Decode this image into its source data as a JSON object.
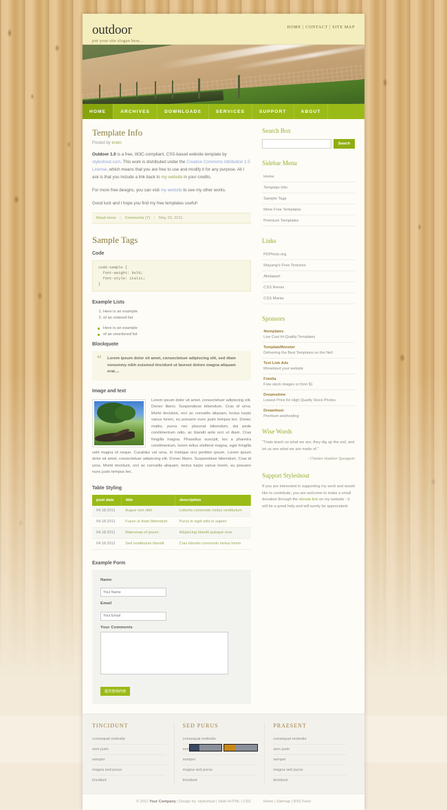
{
  "site": {
    "logo": "outdoor",
    "slogan": "put your site slogan here...",
    "toplinks": [
      "HOME",
      "CONTACT",
      "SITE MAP"
    ],
    "nav": [
      "HOME",
      "ARCHIVES",
      "DOWNLOADS",
      "SERVICES",
      "SUPPORT",
      "ABOUT"
    ],
    "nav_active": "HOME",
    "banner_image": "coastal-beach-fence-photo"
  },
  "post": {
    "title": "Template Info",
    "meta_prefix": "Posted by",
    "meta_author": "erwin",
    "p1_lead": "Outdoor 1.0",
    "p1_a": " is a free, W3C-compliant, CSS-based website template by ",
    "p1_link1": "styleshout.com",
    "p1_b": ". This work is distributed under the ",
    "p1_link2": "Creative Commons Attribution 2.5 License",
    "p1_c": ", which means that you are free to use and modify it for any purpose. All I ask is that you include a link back to ",
    "p1_link3": "my website",
    "p1_d": " in your credits.",
    "p2_a": "For more free designs, you can visit ",
    "p2_link": "my website",
    "p2_b": " to see my other works.",
    "p3": "Good luck and I hope you find my free templates useful!",
    "footer_readmore": "Read more",
    "footer_comments": "Comments (7)",
    "footer_date": "May 20, 2011"
  },
  "sample_tags": {
    "title": "Sample Tags",
    "code_heading": "Code",
    "code_text": "code-sample {\n  font-weight: bold;\n  font-style: italic;\n}",
    "lists_heading": "Example Lists",
    "ordered": [
      "Here is an example",
      "of an ordered list"
    ],
    "unordered": [
      "Here is an example",
      "of an unordered list"
    ],
    "blockquote_heading": "Blockquote",
    "blockquote_mark": "“",
    "blockquote_text": "Lorem ipsum dolor sit amet, consectetuer adipiscing elit, sed diam nonummy nibh euismod tincidunt ut laoreet dolore magna aliquam erat....",
    "imagetext_heading": "Image and text",
    "imagetext_body": "Lorem ipsum dolor sit amet, consectetuer adipiscing elit. Donec libero. Suspendisse bibendum. Cras id urna. Morbi tincidunt, orci ac convallis aliquam, lectus turpis varius lorem, eu posuere nunc justo tempus leo. Donec mattis, purus nec placerat bibendum, dui pede condimentum odio, ac blandit ante orci ut diam. Cras fringilla magna. Phasellus suscipit, leo a pharetra condimentum, lorem tellus eleifend magna, eget fringilla velit magna id neque. Curabitur vel urna. In tristique orci porttitor ipsum. Lorem ipsum dolor sit amet, consectetuer adipiscing elit. Donec libero. Suspendisse bibendum. Cras id urna. Morbi tincidunt, orci ac convallis aliquam, lectus turpis varius lorem, eu posuere nunc justo tempus leo.",
    "image_alt": "tree-and-log-meadow-photo"
  },
  "table": {
    "heading": "Table Styling",
    "columns": [
      "post date",
      "title",
      "description"
    ],
    "rows": [
      [
        "04.18.2011",
        "Augue non nibh",
        "Lobortis commodo metus vestibulum"
      ],
      [
        "04.18.2011",
        "Fusce ut diam bibendum",
        "Purus in eget odio in sapien"
      ],
      [
        "04.18.2011",
        "Maecenas et ipsum",
        "Adipiscing blandit quisque eros"
      ],
      [
        "04.18.2011",
        "Sed vestibulum blandit",
        "Cras lobortis commodo metus lorem"
      ]
    ]
  },
  "form": {
    "heading": "Example Form",
    "name_label": "Name",
    "name_placeholder": "Your Name",
    "email_label": "Email",
    "email_placeholder": "Your Email",
    "comments_label": "Your Comments",
    "comments_value": "",
    "submit_label": "提交查询内容"
  },
  "sidebar": {
    "search_title": "Search Box",
    "search_placeholder": "",
    "search_value": "",
    "search_button": "Search",
    "menu_title": "Sidebar Menu",
    "menu_items": [
      "Home",
      "Template Info",
      "Sample Tags",
      "More Free Templates",
      "Premium Templates"
    ],
    "links_title": "Links",
    "links_items": [
      "PDPhoto.org",
      "Mayang's Free Textures",
      "Alistapart",
      "CSS Remix",
      "CSS Mania"
    ],
    "sponsors_title": "Sponsors",
    "sponsors": [
      {
        "name": "4templates",
        "desc": "Low Cost Hi-Quality Templates"
      },
      {
        "name": "TemplateMonster",
        "desc": "Delivering the Best Templates on the Net!"
      },
      {
        "name": "Text Link Ads",
        "desc": "Monetized your website"
      },
      {
        "name": "Fotolia",
        "desc": "Free stock images or from $1"
      },
      {
        "name": "Dreamstime",
        "desc": "Lowest Price for High Quality Stock Photos"
      },
      {
        "name": "Dreamhost",
        "desc": "Premium webhosting"
      }
    ],
    "wise_title": "Wise Words",
    "wise_quote": "\"Trials teach us what we are; they dig up the soil, and let us see what we are made of.\"",
    "wise_attrib": "- Charles Haddon Spurgeon",
    "support_title": "Support Styleshout",
    "support_a": "If you are interested in supporting my work and would like to contribute, you are welcome to make a small donation through the ",
    "support_link": "donate link",
    "support_b": " on my website - it will be a great help and will surely be appreciated."
  },
  "footer": {
    "columns": [
      {
        "title": "TINCIDUNT",
        "items": [
          "consequat molestie",
          "sem justo",
          "semper",
          "magna sed purus",
          "tincidunt"
        ]
      },
      {
        "title": "SED PURUS",
        "items": [
          "consequat molestie",
          "sem justo",
          "semper",
          "magna sed purus",
          "tincidunt"
        ]
      },
      {
        "title": "PRAESENT",
        "items": [
          "consequat molestie",
          "sem justo",
          "semper",
          "magna sed purus",
          "tincidunt"
        ]
      }
    ],
    "copyright_prefix": "© 2011 ",
    "company": "Your Company",
    "design_by_label": " | Design by: ",
    "design_by": "styleshout",
    "valid_xhtml": "Valid XHTML",
    "css": "CSS",
    "home": "Home",
    "sitemap": "Sitemap",
    "rss": "RSS Feed",
    "badge1": "W3C XHTML",
    "badge2": "W3C CSS"
  }
}
